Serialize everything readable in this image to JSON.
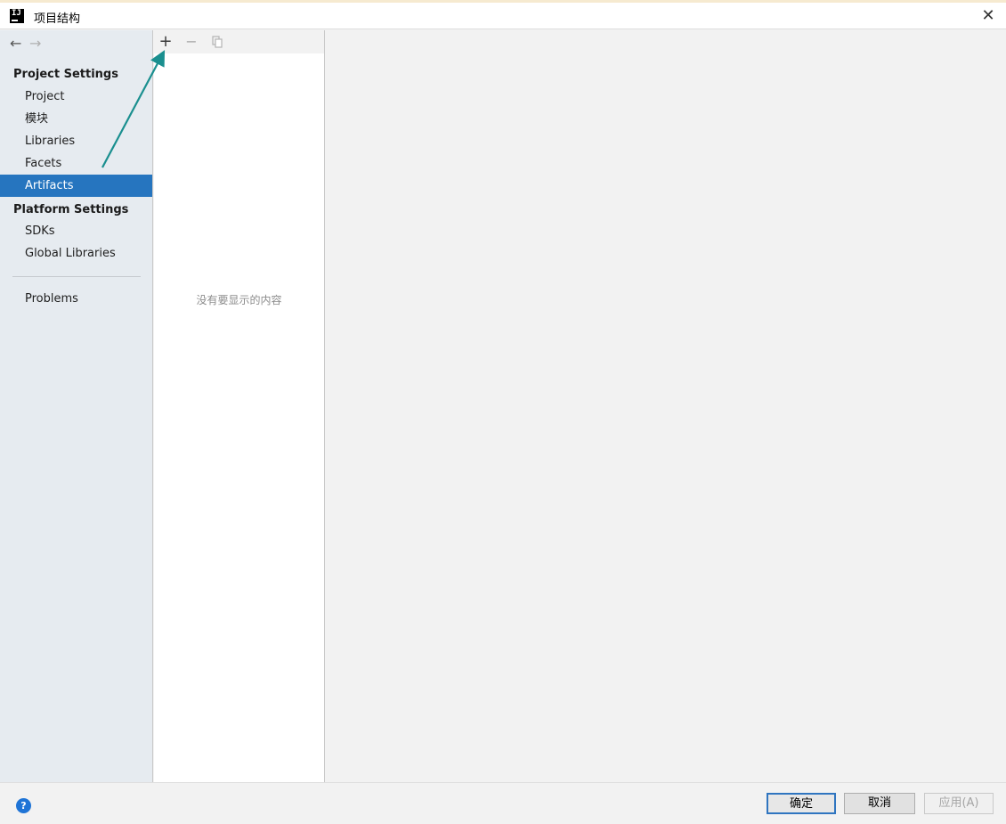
{
  "window": {
    "title": "项目结构",
    "close_glyph": "✕"
  },
  "sidebar": {
    "nav_back": "←",
    "nav_forward": "→",
    "project_settings_header": "Project Settings",
    "project_items": [
      {
        "label": "Project"
      },
      {
        "label": "模块"
      },
      {
        "label": "Libraries"
      },
      {
        "label": "Facets"
      },
      {
        "label": "Artifacts",
        "selected": true
      }
    ],
    "platform_settings_header": "Platform Settings",
    "platform_items": [
      {
        "label": "SDKs"
      },
      {
        "label": "Global Libraries"
      }
    ],
    "problems_label": "Problems"
  },
  "list_panel": {
    "toolbar": {
      "add": "+",
      "remove": "−"
    },
    "empty_text": "没有要显示的内容"
  },
  "footer": {
    "help": "?",
    "ok": "确定",
    "cancel": "取消",
    "apply": "应用(A)"
  },
  "colors": {
    "selection": "#2675bf",
    "annotation_arrow": "#1a8f8f",
    "sidebar_bg": "#e6ebf0",
    "help_icon": "#1f74d6"
  }
}
